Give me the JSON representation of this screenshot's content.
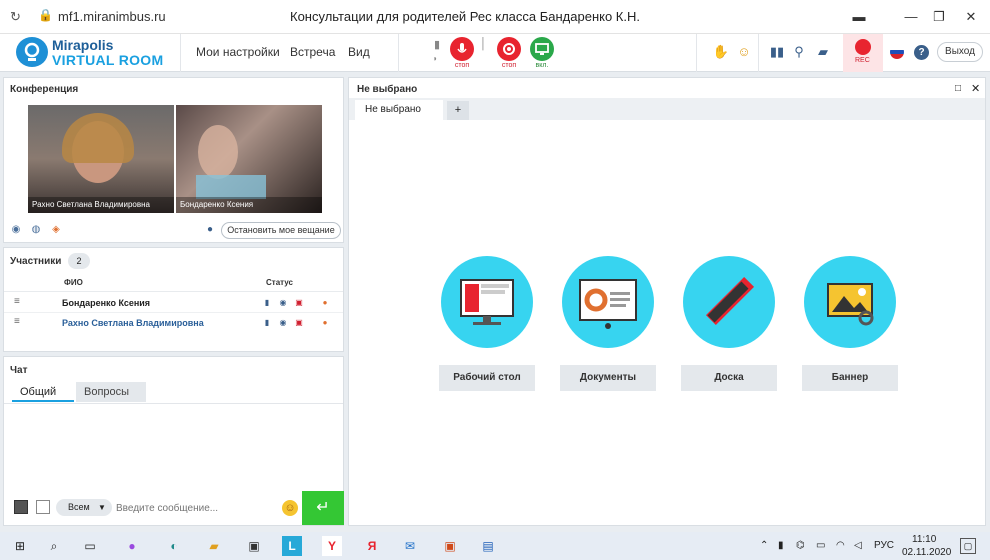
{
  "browser": {
    "url": "mf1.miranimbus.ru",
    "title": "Консультации для родителей Рес класса Бандаренко К.Н."
  },
  "header": {
    "logo_line1": "Mirapolis",
    "logo_line2": "VIRTUAL ROOM",
    "menu": [
      "Мои настройки",
      "Встреча",
      "Вид"
    ],
    "mic_label": "стоп",
    "cam_label": "стоп",
    "screen_label": "вкл.",
    "rec_label": "REC",
    "exit_label": "Выход"
  },
  "conference": {
    "title": "Конференция",
    "videos": [
      {
        "name": "Рахно Светлана  Владимировна"
      },
      {
        "name": "Бондаренко  Ксения"
      }
    ],
    "stop_button": "Остановить мое вещание"
  },
  "participants": {
    "title": "Участники",
    "count": "2",
    "col_name": "ФИО",
    "col_status": "Статус",
    "rows": [
      {
        "name": "Бондаренко  Ксения"
      },
      {
        "name": "Рахно Светлана  Владимировна"
      }
    ]
  },
  "chat": {
    "title": "Чат",
    "tabs": [
      "Общий",
      "Вопросы"
    ],
    "to_label": "Всем",
    "placeholder": "Введите сообщение..."
  },
  "main": {
    "title": "Не выбрано",
    "tab_label": "Не выбрано",
    "add_tab": "+",
    "options": [
      {
        "label": "Рабочий стол"
      },
      {
        "label": "Документы"
      },
      {
        "label": "Доска"
      },
      {
        "label": "Баннер"
      }
    ]
  },
  "taskbar": {
    "lang": "РУС",
    "time": "11:10",
    "date": "02.11.2020"
  },
  "colors": {
    "accent": "#1aa0e0",
    "stop_red": "#e8242f",
    "send_green": "#34c734",
    "circle": "#37d4f0"
  }
}
